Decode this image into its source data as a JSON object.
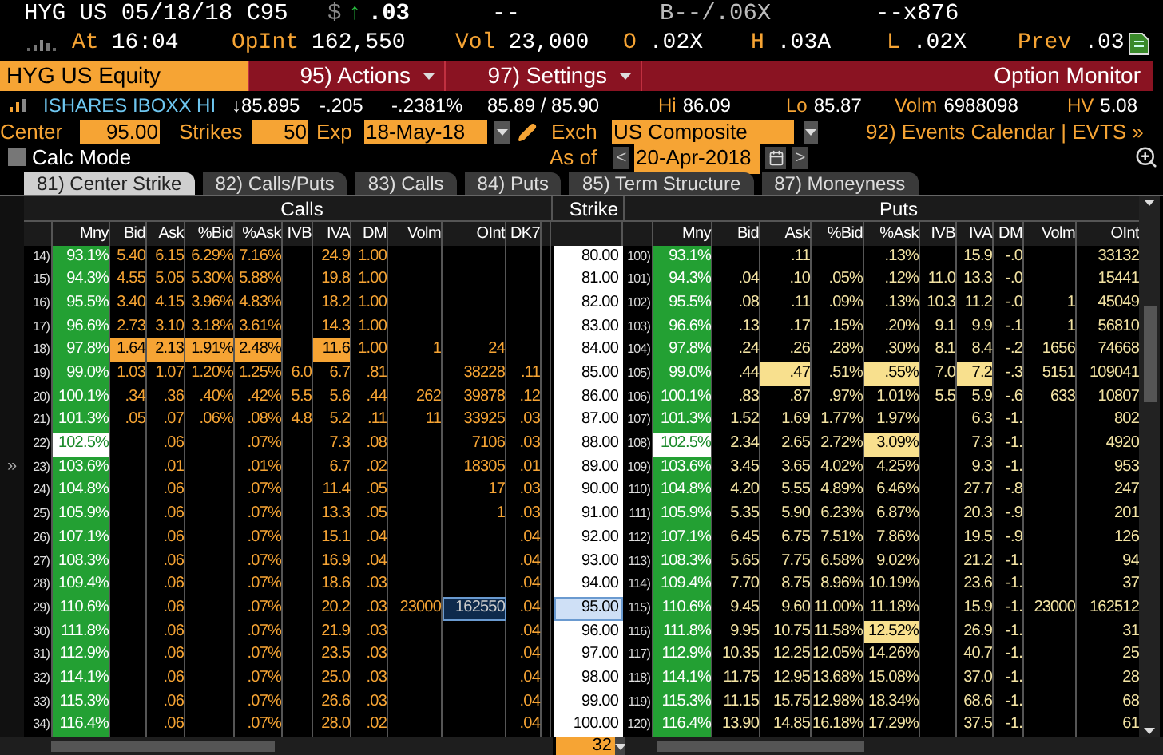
{
  "quote": {
    "title": "HYG US 05/18/18 C95",
    "currency": "$",
    "arrow": "↑",
    "last": ".03",
    "change": "--",
    "bid_ask": "B--/.06X",
    "size": "--x876"
  },
  "stats": [
    {
      "label": "At",
      "value": "16:04"
    },
    {
      "label": "OpInt",
      "value": "162,550"
    },
    {
      "label": "Vol",
      "value": "23,000"
    },
    {
      "label": "O",
      "value": ".02X"
    },
    {
      "label": "H",
      "value": ".03A"
    },
    {
      "label": "L",
      "value": ".02X"
    },
    {
      "label": "Prev",
      "value": ".03"
    }
  ],
  "command_bar": {
    "security": "HYG US Equity",
    "menus": [
      "95) Actions",
      "97) Settings"
    ],
    "title": "Option Monitor"
  },
  "underlying": {
    "name": "ISHARES IBOXX HI",
    "items": [
      {
        "value": "↓85.895"
      },
      {
        "value": "-.205"
      },
      {
        "value": "-.2381%"
      },
      {
        "value": "85.89 / 85.90"
      },
      {
        "label": "Hi",
        "value": "86.09"
      },
      {
        "label": "Lo",
        "value": "85.87"
      },
      {
        "label": "Volm",
        "value": "6988098"
      },
      {
        "label": "HV",
        "value": "5.08"
      }
    ]
  },
  "controls": {
    "center_label": "Center",
    "center": "95.00",
    "strikes_label": "Strikes",
    "strikes": "50",
    "exp_label": "Exp",
    "exp": "18-May-18",
    "exch_label": "Exch",
    "exch": "US Composite",
    "events": "92) Events Calendar | EVTS »"
  },
  "calc_mode": {
    "label": "Calc Mode",
    "checked": false
  },
  "as_of": {
    "label": "As of",
    "prev": "<",
    "date": "20-Apr-2018",
    "next": ">"
  },
  "tabs": [
    {
      "label": "81) Center Strike",
      "selected": true
    },
    {
      "label": "82) Calls/Puts",
      "selected": false
    },
    {
      "label": "83) Calls",
      "selected": false
    },
    {
      "label": "84) Puts",
      "selected": false
    },
    {
      "label": "85) Term Structure",
      "selected": false
    },
    {
      "label": "87) Moneyness",
      "selected": false
    }
  ],
  "table": {
    "calls_title": "Calls",
    "strike_title": "Strike",
    "puts_title": "Puts",
    "expand_marker": "»",
    "call_columns": [
      "Mny",
      "Bid",
      "Ask",
      "%Bid",
      "%Ask",
      "IVB",
      "IVA",
      "DM",
      "Volm",
      "OInt",
      "DK7"
    ],
    "put_columns": [
      "Mny",
      "Bid",
      "Ask",
      "%Bid",
      "%Ask",
      "IVB",
      "IVA",
      "DM",
      "Volm",
      "OInt"
    ],
    "rows": [
      {
        "atm": false,
        "selected": false,
        "strike": "80.00",
        "call": {
          "num": "14)",
          "mny": "93.1%",
          "bid": "5.40",
          "ask": "6.15",
          "pct_bid": "6.29%",
          "pct_ask": "7.16%",
          "iva": "24.9",
          "dm": "1.00"
        },
        "put": {
          "num": "100)",
          "mny": "93.1%",
          "ask": ".11",
          "pct_ask": ".13%",
          "iva": "15.9",
          "dm": "-.0",
          "oint": "33132"
        }
      },
      {
        "atm": false,
        "selected": false,
        "strike": "81.00",
        "call": {
          "num": "15)",
          "mny": "94.3%",
          "bid": "4.55",
          "ask": "5.05",
          "pct_bid": "5.30%",
          "pct_ask": "5.88%",
          "iva": "19.8",
          "dm": "1.00"
        },
        "put": {
          "num": "101)",
          "mny": "94.3%",
          "bid": ".04",
          "ask": ".10",
          "pct_bid": ".05%",
          "pct_ask": ".12%",
          "ivb": "11.0",
          "iva": "13.3",
          "dm": "-.0",
          "oint": "15441"
        }
      },
      {
        "atm": false,
        "selected": false,
        "strike": "82.00",
        "call": {
          "num": "16)",
          "mny": "95.5%",
          "bid": "3.40",
          "ask": "4.15",
          "pct_bid": "3.96%",
          "pct_ask": "4.83%",
          "iva": "18.2",
          "dm": "1.00"
        },
        "put": {
          "num": "102)",
          "mny": "95.5%",
          "bid": ".08",
          "ask": ".11",
          "pct_bid": ".09%",
          "pct_ask": ".13%",
          "ivb": "10.3",
          "iva": "11.2",
          "dm": "-.0",
          "volm": "1",
          "oint": "45049"
        }
      },
      {
        "atm": false,
        "selected": false,
        "strike": "83.00",
        "call": {
          "num": "17)",
          "mny": "96.6%",
          "bid": "2.73",
          "ask": "3.10",
          "pct_bid": "3.18%",
          "pct_ask": "3.61%",
          "iva": "14.3",
          "dm": "1.00"
        },
        "put": {
          "num": "103)",
          "mny": "96.6%",
          "bid": ".13",
          "ask": ".17",
          "pct_bid": ".15%",
          "pct_ask": ".20%",
          "ivb": "9.1",
          "iva": "9.9",
          "dm": "-.1",
          "volm": "1",
          "oint": "56810"
        }
      },
      {
        "atm": false,
        "selected": false,
        "strike": "84.00",
        "call": {
          "num": "18)",
          "mny": "97.8%",
          "bid": {
            "text": "1.64",
            "highlight": true
          },
          "ask": {
            "text": "2.13",
            "highlight": true
          },
          "pct_bid": {
            "text": "1.91%",
            "highlight": true
          },
          "pct_ask": {
            "text": "2.48%",
            "highlight": true
          },
          "iva": {
            "text": "11.6",
            "highlight": true
          },
          "dm": "1.00",
          "volm": "1",
          "oint": "24"
        },
        "put": {
          "num": "104)",
          "mny": "97.8%",
          "bid": ".24",
          "ask": ".26",
          "pct_bid": ".28%",
          "pct_ask": ".30%",
          "ivb": "8.1",
          "iva": "8.4",
          "dm": "-.2",
          "volm": "1656",
          "oint": "74668"
        }
      },
      {
        "atm": false,
        "selected": false,
        "strike": "85.00",
        "call": {
          "num": "19)",
          "mny": "99.0%",
          "bid": "1.03",
          "ask": "1.07",
          "pct_bid": "1.20%",
          "pct_ask": "1.25%",
          "ivb": "6.0",
          "iva": "6.7",
          "dm": ".81",
          "oint": "38228",
          "dk7": ".11"
        },
        "put": {
          "num": "105)",
          "mny": "99.0%",
          "bid": ".44",
          "ask": {
            "text": ".47",
            "highlight": true
          },
          "pct_bid": ".51%",
          "pct_ask": {
            "text": ".55%",
            "highlight": true
          },
          "ivb": "7.0",
          "iva": {
            "text": "7.2",
            "highlight": true
          },
          "dm": "-.3",
          "volm": "5151",
          "oint": "109041"
        }
      },
      {
        "atm": false,
        "selected": false,
        "strike": "86.00",
        "call": {
          "num": "20)",
          "mny": "100.1%",
          "bid": ".34",
          "ask": ".36",
          "pct_bid": ".40%",
          "pct_ask": ".42%",
          "ivb": "5.5",
          "iva": "5.6",
          "dm": ".44",
          "volm": "262",
          "oint": "39878",
          "dk7": ".12"
        },
        "put": {
          "num": "106)",
          "mny": "100.1%",
          "bid": ".83",
          "ask": ".87",
          "pct_bid": ".97%",
          "pct_ask": "1.01%",
          "ivb": "5.5",
          "iva": "5.9",
          "dm": "-.6",
          "volm": "633",
          "oint": "10807"
        }
      },
      {
        "atm": false,
        "selected": false,
        "strike": "87.00",
        "call": {
          "num": "21)",
          "mny": "101.3%",
          "bid": ".05",
          "ask": ".07",
          "pct_bid": ".06%",
          "pct_ask": ".08%",
          "ivb": "4.8",
          "iva": "5.2",
          "dm": ".11",
          "volm": "11",
          "oint": "33925",
          "dk7": ".03"
        },
        "put": {
          "num": "107)",
          "mny": "101.3%",
          "bid": "1.52",
          "ask": "1.69",
          "pct_bid": "1.77%",
          "pct_ask": "1.97%",
          "iva": "6.3",
          "dm": "-1.",
          "oint": "802"
        }
      },
      {
        "atm": true,
        "selected": false,
        "strike": "88.00",
        "call": {
          "num": "22)",
          "mny": "102.5%",
          "ask": ".06",
          "pct_ask": ".07%",
          "iva": "7.3",
          "dm": ".08",
          "oint": "7106",
          "dk7": ".03"
        },
        "put": {
          "num": "108)",
          "mny": "102.5%",
          "bid": "2.34",
          "ask": "2.65",
          "pct_bid": "2.72%",
          "pct_ask": {
            "text": "3.09%",
            "highlight": true
          },
          "iva": "7.3",
          "dm": "-1.",
          "oint": "4920"
        }
      },
      {
        "atm": false,
        "selected": false,
        "strike": "89.00",
        "call": {
          "num": "23)",
          "mny": "103.6%",
          "ask": ".01",
          "pct_ask": ".01%",
          "iva": "6.7",
          "dm": ".02",
          "oint": "18305",
          "dk7": ".01"
        },
        "put": {
          "num": "109)",
          "mny": "103.6%",
          "bid": "3.45",
          "ask": "3.65",
          "pct_bid": "4.02%",
          "pct_ask": "4.25%",
          "iva": "9.3",
          "dm": "-1.",
          "oint": "953"
        }
      },
      {
        "atm": false,
        "selected": false,
        "strike": "90.00",
        "call": {
          "num": "24)",
          "mny": "104.8%",
          "ask": ".06",
          "pct_ask": ".07%",
          "iva": "11.4",
          "dm": ".05",
          "oint": "17",
          "dk7": ".03"
        },
        "put": {
          "num": "110)",
          "mny": "104.8%",
          "bid": "4.20",
          "ask": "5.55",
          "pct_bid": "4.89%",
          "pct_ask": "6.46%",
          "iva": "27.7",
          "dm": "-.8",
          "oint": "247"
        }
      },
      {
        "atm": false,
        "selected": false,
        "strike": "91.00",
        "call": {
          "num": "25)",
          "mny": "105.9%",
          "ask": ".06",
          "pct_ask": ".07%",
          "iva": "13.3",
          "dm": ".05",
          "oint": "1",
          "dk7": ".03"
        },
        "put": {
          "num": "111)",
          "mny": "105.9%",
          "bid": "5.35",
          "ask": "5.90",
          "pct_bid": "6.23%",
          "pct_ask": "6.87%",
          "iva": "20.3",
          "dm": "-.9",
          "oint": "201"
        }
      },
      {
        "atm": false,
        "selected": false,
        "strike": "92.00",
        "call": {
          "num": "26)",
          "mny": "107.1%",
          "ask": ".06",
          "pct_ask": ".07%",
          "iva": "15.1",
          "dm": ".04",
          "dk7": ".04"
        },
        "put": {
          "num": "112)",
          "mny": "107.1%",
          "bid": "6.45",
          "ask": "6.75",
          "pct_bid": "7.51%",
          "pct_ask": "7.86%",
          "iva": "19.5",
          "dm": "-.9",
          "oint": "126"
        }
      },
      {
        "atm": false,
        "selected": false,
        "strike": "93.00",
        "call": {
          "num": "27)",
          "mny": "108.3%",
          "ask": ".06",
          "pct_ask": ".07%",
          "iva": "16.9",
          "dm": ".04",
          "dk7": ".04"
        },
        "put": {
          "num": "113)",
          "mny": "108.3%",
          "bid": "5.65",
          "ask": "7.75",
          "pct_bid": "6.58%",
          "pct_ask": "9.02%",
          "iva": "21.2",
          "dm": "-1.",
          "oint": "94"
        }
      },
      {
        "atm": false,
        "selected": false,
        "strike": "94.00",
        "call": {
          "num": "28)",
          "mny": "109.4%",
          "ask": ".06",
          "pct_ask": ".07%",
          "iva": "18.6",
          "dm": ".03",
          "dk7": ".04"
        },
        "put": {
          "num": "114)",
          "mny": "109.4%",
          "bid": "7.70",
          "ask": "8.75",
          "pct_bid": "8.96%",
          "pct_ask": "10.19%",
          "iva": "23.6",
          "dm": "-1.",
          "oint": "37"
        }
      },
      {
        "atm": false,
        "selected": true,
        "strike": "95.00",
        "call": {
          "num": "29)",
          "mny": "110.6%",
          "ask": ".06",
          "pct_ask": ".07%",
          "iva": "20.2",
          "dm": ".03",
          "volm": "23000",
          "oint": "162550",
          "dk7": ".04"
        },
        "put": {
          "num": "115)",
          "mny": "110.6%",
          "bid": "9.45",
          "ask": "9.60",
          "pct_bid": "11.00%",
          "pct_ask": "11.18%",
          "iva": "15.9",
          "dm": "-1.",
          "volm": "23000",
          "oint": "162512"
        }
      },
      {
        "atm": false,
        "selected": false,
        "strike": "96.00",
        "call": {
          "num": "30)",
          "mny": "111.8%",
          "ask": ".06",
          "pct_ask": ".07%",
          "iva": "21.9",
          "dm": ".03",
          "dk7": ".04"
        },
        "put": {
          "num": "116)",
          "mny": "111.8%",
          "bid": "9.95",
          "ask": "10.75",
          "pct_bid": "11.58%",
          "pct_ask": {
            "text": "12.52%",
            "highlight": true
          },
          "iva": "26.9",
          "dm": "-1.",
          "oint": "31"
        }
      },
      {
        "atm": false,
        "selected": false,
        "strike": "97.00",
        "call": {
          "num": "31)",
          "mny": "112.9%",
          "ask": ".06",
          "pct_ask": ".07%",
          "iva": "23.5",
          "dm": ".03",
          "dk7": ".04"
        },
        "put": {
          "num": "117)",
          "mny": "112.9%",
          "bid": "10.35",
          "ask": "12.25",
          "pct_bid": "12.05%",
          "pct_ask": "14.26%",
          "iva": "40.7",
          "dm": "-1.",
          "oint": "25"
        }
      },
      {
        "atm": false,
        "selected": false,
        "strike": "98.00",
        "call": {
          "num": "32)",
          "mny": "114.1%",
          "ask": ".06",
          "pct_ask": ".07%",
          "iva": "25.0",
          "dm": ".03",
          "dk7": ".04"
        },
        "put": {
          "num": "118)",
          "mny": "114.1%",
          "bid": "11.75",
          "ask": "12.95",
          "pct_bid": "13.68%",
          "pct_ask": "15.08%",
          "iva": "37.0",
          "dm": "-1.",
          "oint": "28"
        }
      },
      {
        "atm": false,
        "selected": false,
        "strike": "99.00",
        "call": {
          "num": "33)",
          "mny": "115.3%",
          "ask": ".06",
          "pct_ask": ".07%",
          "iva": "26.6",
          "dm": ".03",
          "dk7": ".04"
        },
        "put": {
          "num": "119)",
          "mny": "115.3%",
          "bid": "11.15",
          "ask": "15.75",
          "pct_bid": "12.98%",
          "pct_ask": "18.34%",
          "iva": "68.6",
          "dm": "-1.",
          "oint": "68"
        }
      },
      {
        "atm": false,
        "selected": false,
        "strike": "100.00",
        "call": {
          "num": "34)",
          "mny": "116.4%",
          "ask": ".06",
          "pct_ask": ".07%",
          "iva": "28.0",
          "dm": ".02",
          "dk7": ".04"
        },
        "put": {
          "num": "120)",
          "mny": "116.4%",
          "bid": "13.90",
          "ask": "14.85",
          "pct_bid": "16.18%",
          "pct_ask": "17.29%",
          "iva": "37.5",
          "dm": "-1.",
          "oint": "61"
        }
      }
    ],
    "visible_count": "32"
  }
}
